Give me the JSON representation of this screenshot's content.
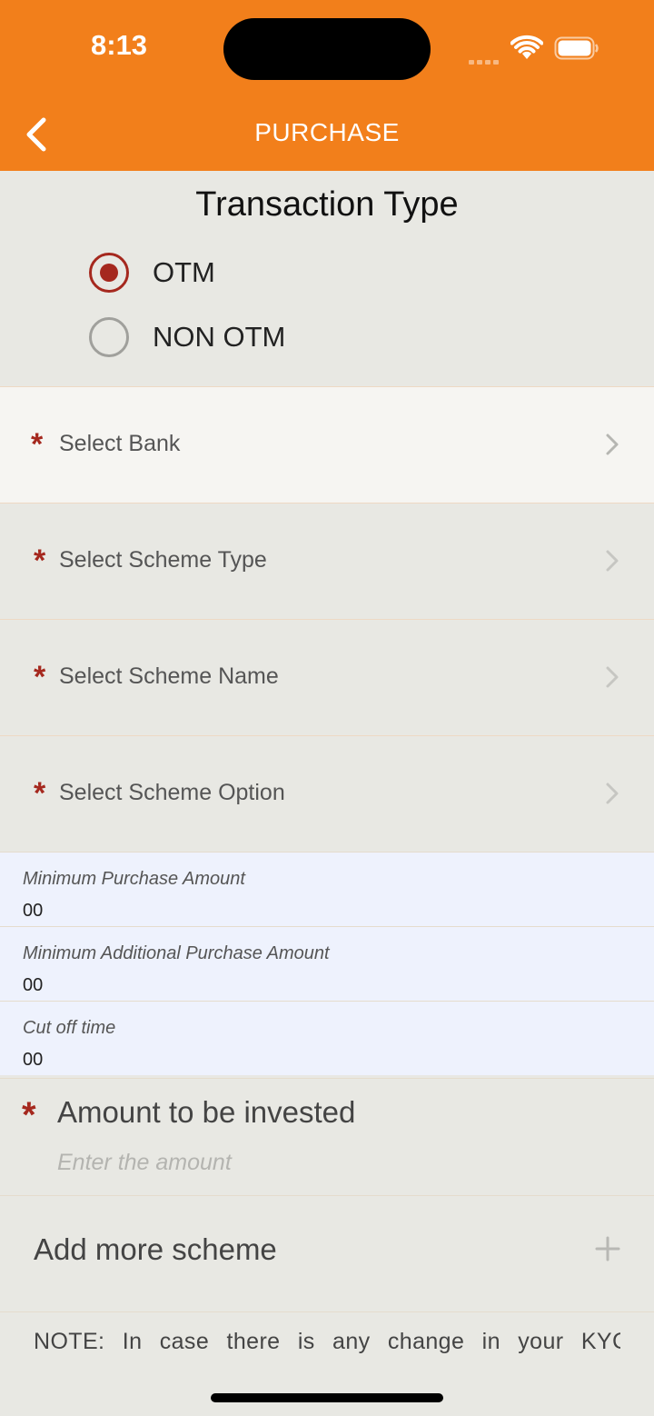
{
  "status_bar": {
    "time": "8:13"
  },
  "header": {
    "title": "PURCHASE"
  },
  "transaction": {
    "title": "Transaction Type",
    "options": [
      {
        "label": "OTM",
        "selected": true
      },
      {
        "label": "NON OTM",
        "selected": false
      }
    ]
  },
  "selects": [
    {
      "label": "Select Bank"
    },
    {
      "label": "Select Scheme Type"
    },
    {
      "label": "Select Scheme Name"
    },
    {
      "label": "Select Scheme Option"
    }
  ],
  "info": [
    {
      "label": "Minimum Purchase Amount",
      "value": "00"
    },
    {
      "label": "Minimum Additional Purchase Amount",
      "value": "00"
    },
    {
      "label": "Cut off time",
      "value": "00"
    }
  ],
  "amount": {
    "title": "Amount to be invested",
    "placeholder": "Enter the amount",
    "required_mark": "*"
  },
  "add_more": {
    "label": "Add more scheme"
  },
  "note": "NOTE: In case there is any change in your KYC",
  "colors": {
    "header": "#f27f1b",
    "accent": "#a5281e",
    "background": "#e8e8e3"
  }
}
